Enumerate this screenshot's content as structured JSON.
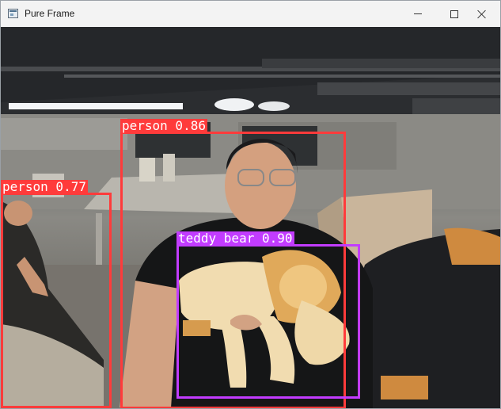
{
  "window": {
    "title": "Pure Frame",
    "controls": {
      "minimize": "minimize",
      "maximize": "maximize",
      "close": "close"
    }
  },
  "detections": [
    {
      "label": "person 0.86",
      "color": "#ff3b3b"
    },
    {
      "label": "person 0.77",
      "color": "#ff3b3b"
    },
    {
      "label": "teddy bear 0.90",
      "color": "#c23cff"
    }
  ]
}
